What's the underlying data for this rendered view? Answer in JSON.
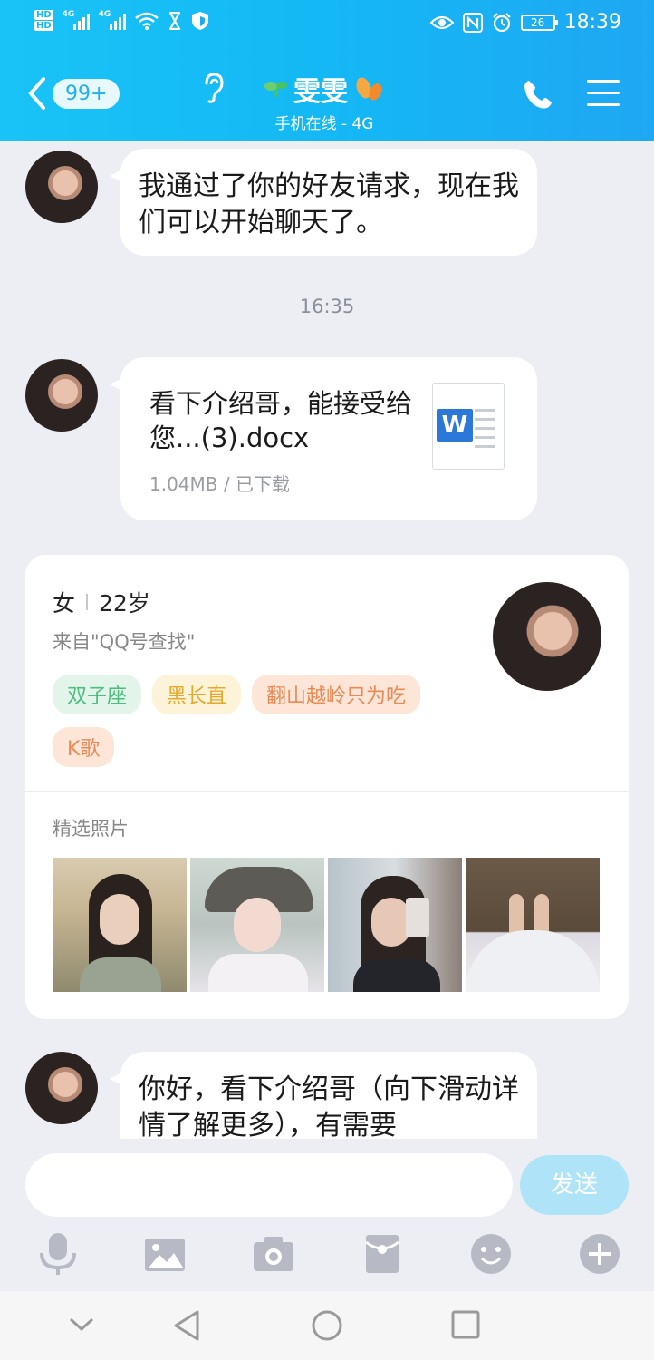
{
  "status_bar": {
    "hd1": "HD",
    "hd2": "HD",
    "net1": "4G",
    "net2": "4G",
    "battery": "26",
    "time": "18:39"
  },
  "header": {
    "unread_badge": "99+",
    "title": "雯雯",
    "subtitle": "手机在线 - 4G"
  },
  "messages": [
    {
      "text": "我通过了你的好友请求，现在我们可以开始聊天了。"
    },
    {
      "file_name": "看下介绍哥，能接受给您...(3).docx",
      "file_meta": "1.04MB / 已下载",
      "file_icon": "W"
    },
    {
      "text": "你好，看下介绍哥（向下滑动详情了解更多），有需要"
    }
  ],
  "timestamp": "16:35",
  "profile_card": {
    "gender": "女",
    "age": "22岁",
    "source": "来自\"QQ号查找\"",
    "tags": [
      "双子座",
      "黑长直",
      "翻山越岭只为吃",
      "K歌"
    ],
    "tag_colors": [
      "#e3f5ea",
      "#fdf3d8",
      "#fde6d8",
      "#fde6d8"
    ],
    "tag_text_colors": [
      "#4bbf7b",
      "#e7a92c",
      "#e98a55",
      "#e98a55"
    ],
    "photos_label": "精选照片"
  },
  "composer": {
    "send_label": "发送"
  },
  "colors": {
    "header_gradient_start": "#19c3f7",
    "header_gradient_end": "#1fa7f3",
    "background": "#eceef4",
    "send_button": "#aee3f8",
    "toolbar_icon": "#b7bac4"
  }
}
